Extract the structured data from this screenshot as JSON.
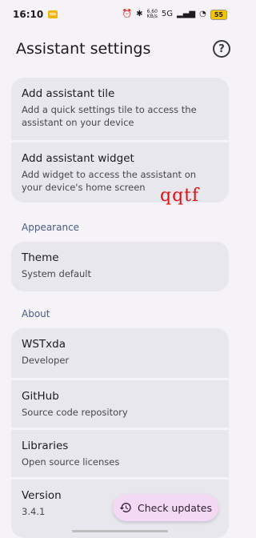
{
  "status_bar": {
    "time": "16:10",
    "net_speed_value": "6.60",
    "net_speed_unit": "KB/s",
    "network": "5G",
    "battery": "55"
  },
  "header": {
    "title": "Assistant settings",
    "help_icon": "help-circle-icon"
  },
  "assistant": {
    "items": [
      {
        "title": "Add assistant tile",
        "subtitle": "Add a quick settings tile to access the assistant on your device"
      },
      {
        "title": "Add assistant widget",
        "subtitle": "Add widget to access the assistant on your device's home screen"
      }
    ]
  },
  "appearance": {
    "section_label": "Appearance",
    "theme": {
      "title": "Theme",
      "subtitle": "System default"
    }
  },
  "about": {
    "section_label": "About",
    "items": [
      {
        "title": "WSTxda",
        "subtitle": "Developer"
      },
      {
        "title": "GitHub",
        "subtitle": "Source code repository"
      },
      {
        "title": "Libraries",
        "subtitle": "Open source licenses"
      },
      {
        "title": "Version",
        "subtitle": "3.4.1"
      }
    ]
  },
  "fab": {
    "label": "Check updates",
    "icon": "history-icon"
  },
  "watermark": "qqtf",
  "colors": {
    "background": "#f5f3f8",
    "card": "#e9e7ee",
    "section_label": "#4a5a8a",
    "fab": "#f3d9f3"
  }
}
